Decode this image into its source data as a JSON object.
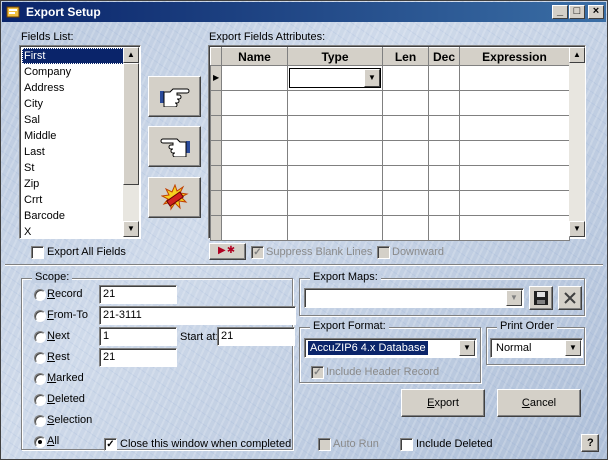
{
  "window": {
    "title": "Export Setup",
    "controls": {
      "minimize": "_",
      "maximize": "□",
      "close": "×"
    }
  },
  "fields_list": {
    "label": "Fields List:",
    "items": [
      "First",
      "Company",
      "Address",
      "City",
      "Sal",
      "Middle",
      "Last",
      "St",
      "Zip",
      "Crrt",
      "Barcode",
      "X"
    ],
    "selected": "First",
    "export_all_label": "Export All Fields",
    "export_all_checked": false
  },
  "move_buttons": {
    "add_icon": "pointing-hand-right-icon",
    "remove_icon": "pointing-hand-left-icon",
    "clear_icon": "explode-icon"
  },
  "attributes": {
    "label": "Export Fields Attributes:",
    "columns": [
      "Name",
      "Type",
      "Len",
      "Dec",
      "Expression"
    ],
    "insert_icon": "insert-row-icon",
    "insert_label": "▶✱",
    "suppress_blank_label": "Suppress Blank Lines",
    "suppress_blank_checked": true,
    "downward_label": "Downward",
    "downward_checked": false
  },
  "scope": {
    "label": "Scope:",
    "options": [
      {
        "key": "R",
        "rest": "ecord",
        "value": "21"
      },
      {
        "key": "F",
        "rest": "rom-To",
        "value": "21-3111"
      },
      {
        "key": "N",
        "rest": "ext",
        "value": "1"
      },
      {
        "key": "R",
        "rest": "est",
        "value": "21"
      },
      {
        "key": "M",
        "rest": "arked"
      },
      {
        "key": "D",
        "rest": "eleted"
      },
      {
        "key": "S",
        "rest": "election"
      },
      {
        "key": "A",
        "rest": "ll"
      }
    ],
    "selected": "All",
    "start_at_label": "Start at:",
    "start_at_value": "21"
  },
  "export_maps": {
    "label": "Export Maps:",
    "value": "",
    "save_icon": "floppy-disk-icon",
    "delete_icon": "x-delete-icon"
  },
  "export_format": {
    "label": "Export Format:",
    "value": "AccuZIP6 4.x Database",
    "include_header_label": "Include Header Record",
    "include_header_checked": true
  },
  "print_order": {
    "label": "Print Order",
    "value": "Normal"
  },
  "buttons": {
    "export_key": "E",
    "export_rest": "xport",
    "cancel_key": "C",
    "cancel_rest": "ancel",
    "help": "?"
  },
  "footer": {
    "close_window_label": "Close this window when completed",
    "close_window_checked": true,
    "auto_run_label": "Auto Run",
    "auto_run_checked": false,
    "include_deleted_label": "Include Deleted",
    "include_deleted_checked": false
  }
}
